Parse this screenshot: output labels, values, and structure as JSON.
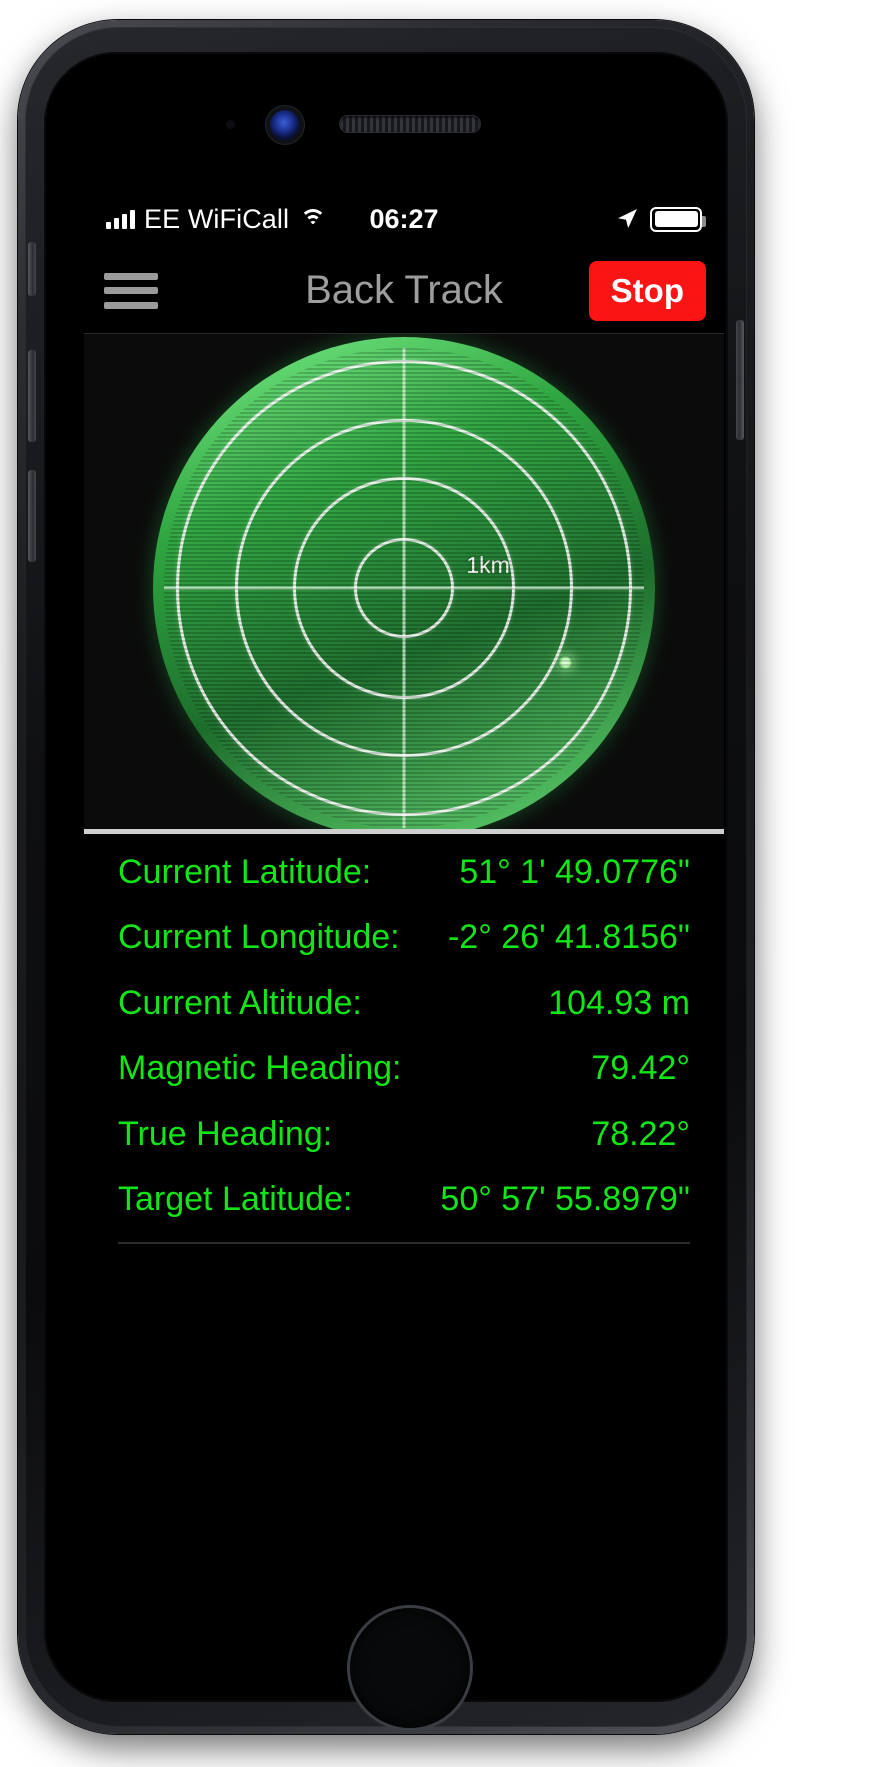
{
  "device": {
    "name": "iphone-space-gray"
  },
  "status_bar": {
    "carrier": "EE WiFiCall",
    "time": "06:27",
    "signal_icon": "signal-bars-icon",
    "wifi_icon": "wifi-icon",
    "location_icon": "location-arrow-icon",
    "battery_icon": "battery-full-icon"
  },
  "nav_bar": {
    "menu_icon": "hamburger-menu-icon",
    "title": "Back Track",
    "action_label": "Stop",
    "action_color": "#fb1414",
    "title_color": "#9d9d9d"
  },
  "radar": {
    "scale_label": "1km",
    "ring_count": 4,
    "sweep_icon": "radar-sweep",
    "blip_icon": "radar-blip",
    "rim_color": "#2fa641",
    "face_color": "#18862f"
  },
  "data": {
    "text_color": "#14e519",
    "rows": [
      {
        "label": "Current Latitude:",
        "value": "51° 1' 49.0776\""
      },
      {
        "label": "Current Longitude:",
        "value": "-2° 26' 41.8156\""
      },
      {
        "label": "Current Altitude:",
        "value": "104.93 m"
      },
      {
        "label": "Magnetic Heading:",
        "value": "79.42°"
      },
      {
        "label": "True Heading:",
        "value": "78.22°"
      },
      {
        "label": "Target Latitude:",
        "value": "50° 57' 55.8979\""
      }
    ]
  }
}
